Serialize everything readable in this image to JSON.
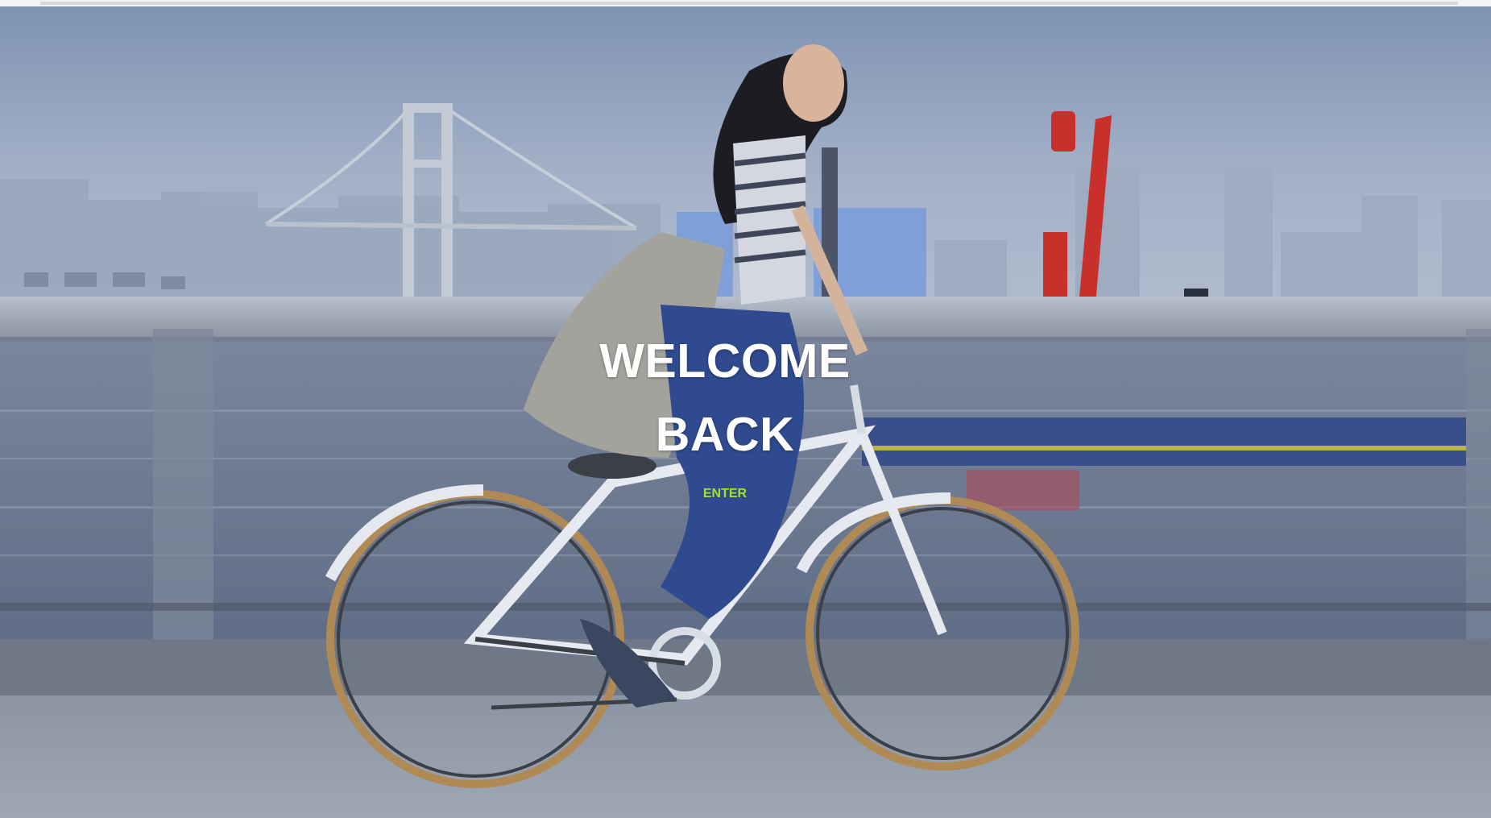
{
  "hero": {
    "title_line1": "WELCOME",
    "title_line2": "BACK",
    "enter_label": "ENTER"
  },
  "colors": {
    "title": "#ffffff",
    "enter_link": "#a4e22a",
    "sky": "#8fa3c0",
    "water": "#6f7d96",
    "railing": "#9aa3b1",
    "road": "#8e98a6"
  }
}
